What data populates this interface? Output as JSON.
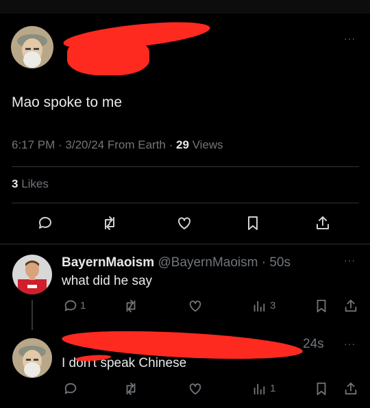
{
  "main_tweet": {
    "text": "Mao spoke to me",
    "meta_time": "6:17 PM · 3/20/24 From Earth · ",
    "views_count": "29",
    "views_label": " Views",
    "likes_count": "3",
    "likes_label": " Likes",
    "more": "···"
  },
  "reply1": {
    "display_name": "BayernMaoism",
    "handle_time": "@BayernMaoism · 50s",
    "text": "what did he say",
    "reply_count": "1",
    "views_count": "3",
    "more": "···"
  },
  "reply2": {
    "time": "24s",
    "text": "I don't speak Chinese",
    "views_count": "1",
    "more": "···"
  },
  "colors": {
    "background": "#000000",
    "text": "#e7e9ea",
    "muted": "#71767b",
    "redaction": "#ff2a1f"
  }
}
